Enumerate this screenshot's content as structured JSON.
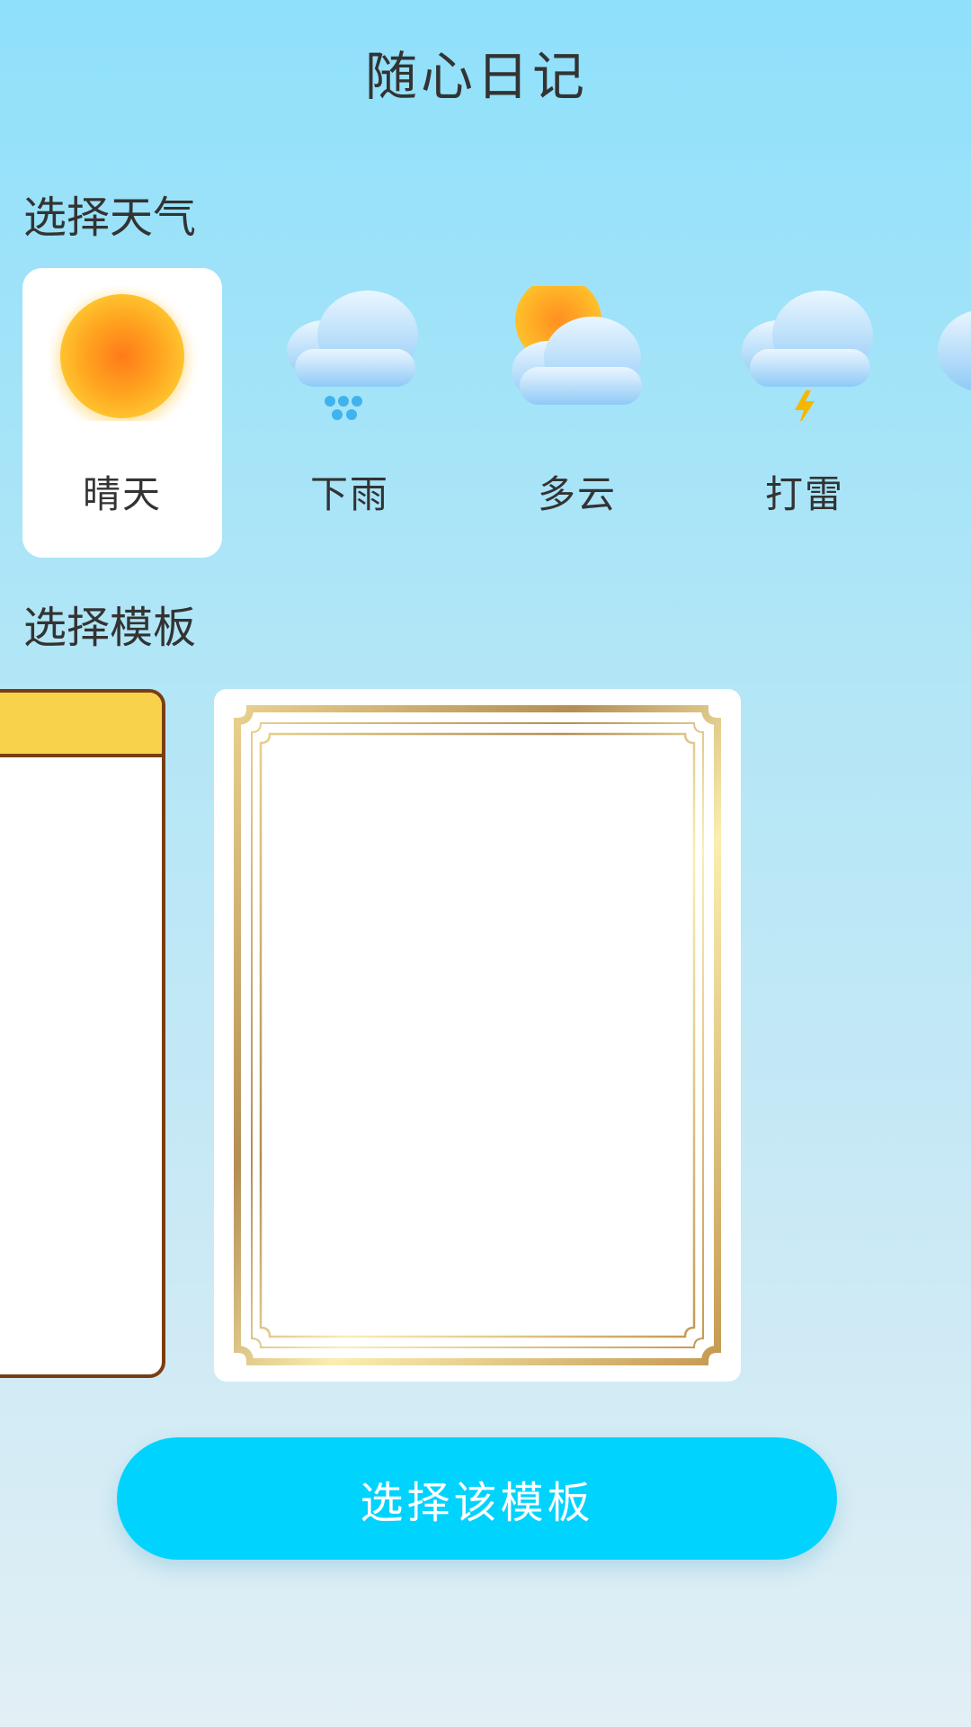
{
  "header": {
    "title": "随心日记"
  },
  "weather_section": {
    "label": "选择天气",
    "items": [
      {
        "label": "晴天",
        "icon": "sun-icon",
        "selected": true
      },
      {
        "label": "下雨",
        "icon": "rain-cloud-icon",
        "selected": false
      },
      {
        "label": "多云",
        "icon": "partly-cloudy-icon",
        "selected": false
      },
      {
        "label": "打雷",
        "icon": "thunder-cloud-icon",
        "selected": false
      }
    ]
  },
  "template_section": {
    "label": "选择模板",
    "templates": [
      {
        "style": "yellow-header-brown-border",
        "partially_visible": true
      },
      {
        "style": "gold-ornate-frame",
        "selected": true
      }
    ]
  },
  "actions": {
    "select_template_label": "选择该模板"
  },
  "colors": {
    "accent": "#00d3fd",
    "card": "#ffffff",
    "text": "#333333",
    "template_yellow": "#f8d24a",
    "template_brown": "#7a3d12",
    "gold": "#c9a45a"
  }
}
